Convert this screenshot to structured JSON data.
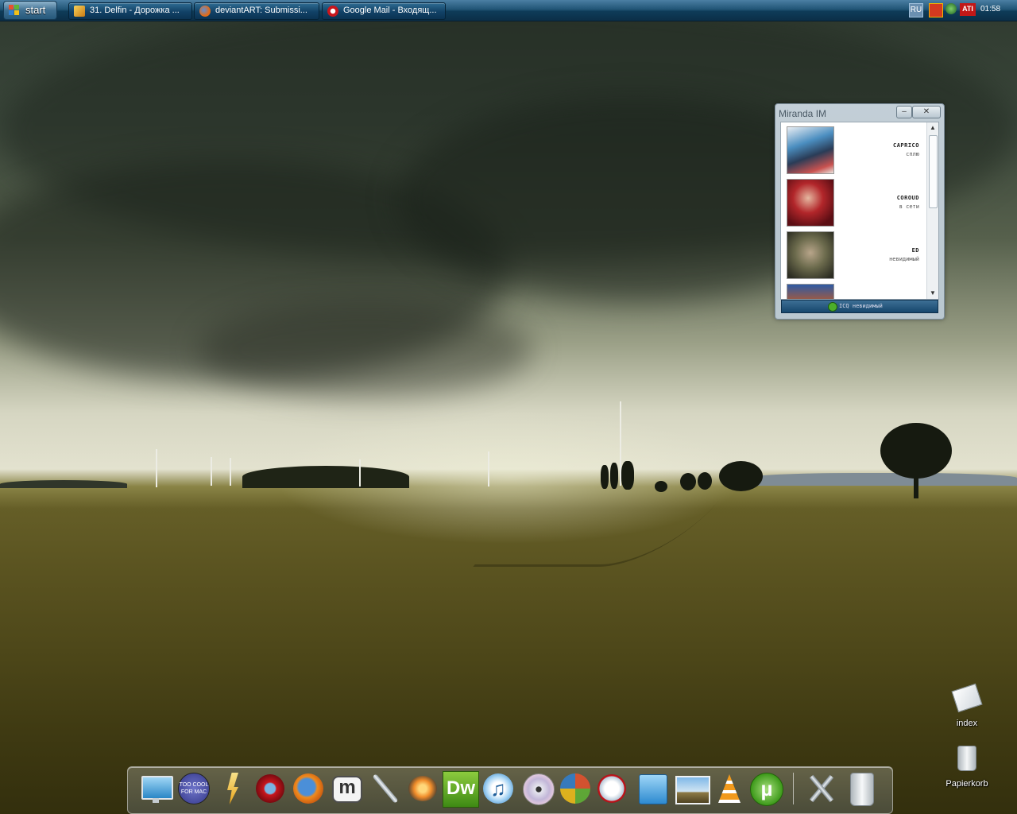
{
  "taskbar": {
    "start_label": "start",
    "tasks": [
      {
        "label": "31. Delfin - Дорожка ...",
        "icon": "media-player-icon"
      },
      {
        "label": "deviantART: Submissi...",
        "icon": "firefox-icon"
      },
      {
        "label": "Google Mail - Входящ...",
        "icon": "opera-icon"
      }
    ],
    "tray": {
      "language": "RU",
      "clock": "01:58",
      "ati_label": "ATI"
    }
  },
  "miranda": {
    "title": "Miranda IM",
    "minimize_glyph": "–",
    "close_glyph": "✕",
    "contacts": [
      {
        "name": "CAPRICO",
        "status": "сплю",
        "avatar_color": "#4b8ec0"
      },
      {
        "name": "COROUD",
        "status": "в сети",
        "avatar_color": "#b2262a"
      },
      {
        "name": "ED",
        "status": "невидимый",
        "avatar_color": "#6b6a4c"
      }
    ],
    "status_bar": "ICQ невидимый"
  },
  "desktop_icons": [
    {
      "label": "index",
      "icon": "document-icon"
    },
    {
      "label": "Papierkorb",
      "icon": "trash-icon"
    }
  ],
  "dock": {
    "items": [
      {
        "name": "monitor-icon"
      },
      {
        "name": "too-cool-for-mac-icon"
      },
      {
        "name": "lightning-icon"
      },
      {
        "name": "opera-icon"
      },
      {
        "name": "firefox-icon"
      },
      {
        "name": "miranda-m-icon"
      },
      {
        "name": "wrench-icon"
      },
      {
        "name": "flower-app-icon"
      },
      {
        "name": "dreamweaver-icon"
      },
      {
        "name": "itunes-icon"
      },
      {
        "name": "dvd-icon"
      },
      {
        "name": "windows-globe-icon"
      },
      {
        "name": "script-icon"
      },
      {
        "name": "mail-icon"
      },
      {
        "name": "picture-icon"
      },
      {
        "name": "vlc-icon"
      },
      {
        "name": "utorrent-icon"
      },
      {
        "name": "tools-icon"
      },
      {
        "name": "trash-can-icon"
      }
    ],
    "dreamweaver_text": "Dw",
    "utorrent_text": "µ",
    "miranda_text": "m",
    "toocool_text": "TOO COOL FOR MAC"
  }
}
